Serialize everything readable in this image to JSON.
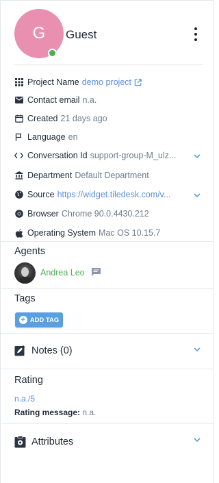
{
  "header": {
    "avatar_letter": "G",
    "avatar_color": "#e98fb0",
    "presence_color": "#4caf50",
    "visitor_name": "Guest",
    "menu_icon": "more-vert-icon"
  },
  "info": {
    "project": {
      "label": "Project Name",
      "value": "demo project",
      "icon": "apps-grid-icon"
    },
    "email": {
      "label": "Contact email",
      "value": "n.a.",
      "icon": "envelope-icon"
    },
    "created": {
      "label": "Created",
      "value": "21 days ago",
      "icon": "calendar-icon"
    },
    "language": {
      "label": "Language",
      "value": "en",
      "icon": "flag-icon"
    },
    "conversation": {
      "label": "Conversation Id",
      "value": "support-group-M_ulz...",
      "icon": "code-icon"
    },
    "department": {
      "label": "Department",
      "value": "Default Department",
      "icon": "bank-icon"
    },
    "source": {
      "label": "Source",
      "value": "https://widget.tiledesk.com/v...",
      "icon": "globe-icon"
    },
    "browser": {
      "label": "Browser",
      "value": "Chrome 90.0.4430.212",
      "icon": "chrome-icon"
    },
    "os": {
      "label": "Operating System",
      "value": "Mac OS 10.15.7",
      "icon": "apple-icon"
    }
  },
  "agents": {
    "title": "Agents",
    "items": [
      {
        "name": "Andrea Leo"
      }
    ]
  },
  "tags": {
    "title": "Tags",
    "add_label": "ADD TAG"
  },
  "notes": {
    "title": "Notes (0)"
  },
  "rating": {
    "title": "Rating",
    "value": "n.a./5",
    "message_label": "Rating message:",
    "message_value": "n.a."
  },
  "attributes": {
    "title": "Attributes"
  },
  "colors": {
    "accent": "#5aa0e0",
    "link": "#5b8fd6",
    "agent_name": "#4caf50"
  }
}
